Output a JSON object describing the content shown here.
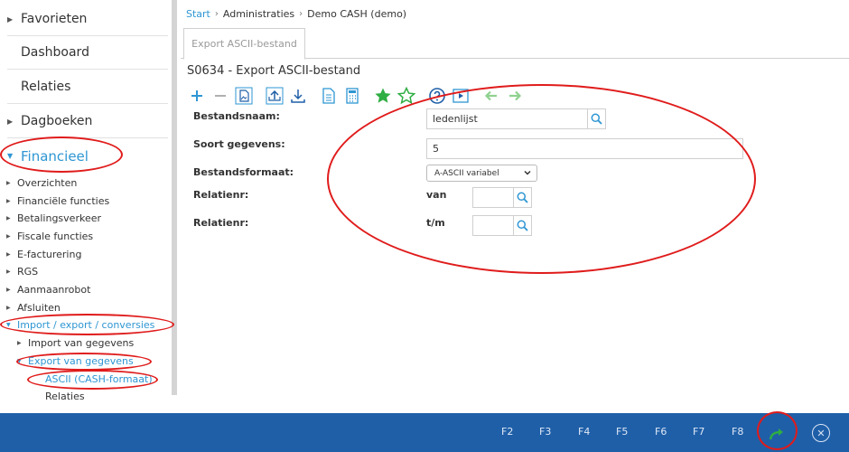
{
  "sidebar": {
    "top_items": [
      {
        "label": "Favorieten"
      },
      {
        "label": "Dashboard"
      },
      {
        "label": "Relaties"
      },
      {
        "label": "Dagboeken"
      },
      {
        "label": "Financieel"
      }
    ],
    "sub_items": [
      {
        "label": "Overzichten"
      },
      {
        "label": "Financiële functies"
      },
      {
        "label": "Betalingsverkeer"
      },
      {
        "label": "Fiscale functies"
      },
      {
        "label": "E-facturering"
      },
      {
        "label": "RGS"
      },
      {
        "label": "Aanmaanrobot"
      },
      {
        "label": "Afsluiten"
      },
      {
        "label": "Import / export / conversies"
      },
      {
        "label": "Import van gegevens"
      },
      {
        "label": "Export van gegevens"
      },
      {
        "label": "ASCII (CASH-formaat)"
      },
      {
        "label": "Relaties"
      }
    ]
  },
  "breadcrumb": {
    "start": "Start",
    "admin": "Administraties",
    "current": "Demo CASH (demo)"
  },
  "tab": {
    "label": "Export ASCII-bestand"
  },
  "page": {
    "title": "S0634 - Export ASCII-bestand"
  },
  "toolbar_icons": [
    "plus-icon",
    "minus-icon",
    "document-image-icon",
    "upload-icon",
    "download-icon",
    "document-icon",
    "calculator-icon",
    "star-filled-icon",
    "star-outline-icon",
    "help-icon",
    "video-icon",
    "arrow-left-icon",
    "arrow-right-icon"
  ],
  "form": {
    "bestandsnaam_label": "Bestandsnaam:",
    "bestandsnaam_value": "ledenlijst",
    "soort_label": "Soort gegevens:",
    "soort_value": "5",
    "formaat_label": "Bestandsformaat:",
    "formaat_value": "A-ASCII variabel",
    "relatienr_label_1": "Relatienr:",
    "van_label": "van",
    "relatienr_label_2": "Relatienr:",
    "tm_label": "t/m"
  },
  "footer": {
    "fkeys": [
      "F2",
      "F3",
      "F4",
      "F5",
      "F6",
      "F7",
      "F8"
    ]
  },
  "colors": {
    "accent": "#2e96d3",
    "footer": "#1f5fa8",
    "annotation": "#e01b1b",
    "green": "#2fae43"
  }
}
